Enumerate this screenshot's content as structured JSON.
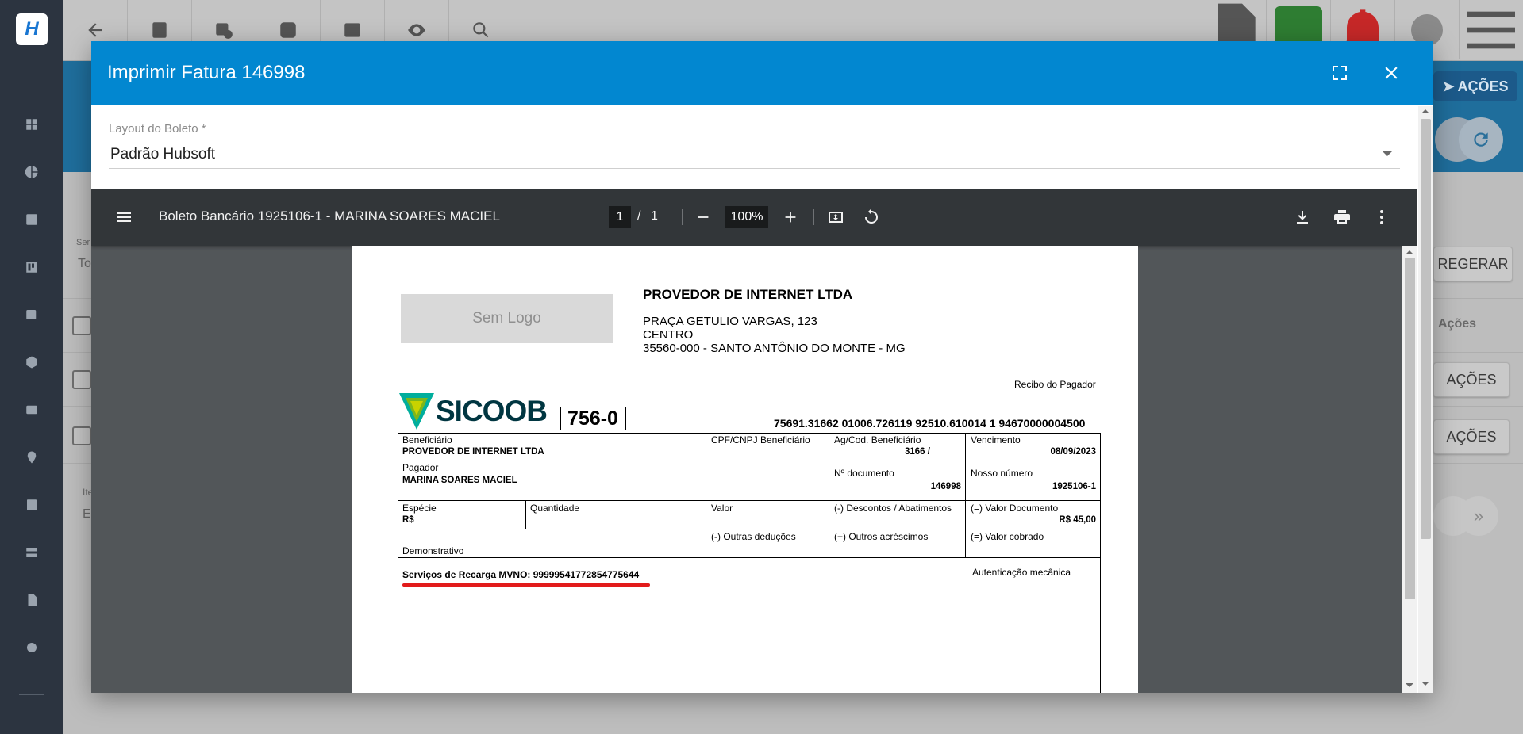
{
  "modal": {
    "title": "Imprimir Fatura 146998",
    "layout_label": "Layout do Boleto *",
    "layout_value": "Padrão Hubsoft"
  },
  "viewer": {
    "title": "Boleto Bancário 1925106-1 - MARINA SOARES MACIEL",
    "page_current": "1",
    "page_sep": "/",
    "page_total": "1",
    "zoom": "100%"
  },
  "boleto": {
    "logo_placeholder": "Sem Logo",
    "company_name": "PROVEDOR DE INTERNET LTDA",
    "address_line1": "PRAÇA GETULIO VARGAS, 123",
    "address_line2": "CENTRO",
    "address_line3": "35560-000 - SANTO ANTÔNIO DO MONTE - MG",
    "receipt_title": "Recibo do Pagador",
    "bank_name": "SICOOB",
    "bank_code": "756-0",
    "digitable_line": "75691.31662 01006.726119 92510.610014 1 94670000004500",
    "beneficiario_label": "Beneficiário",
    "beneficiario_value": "PROVEDOR DE INTERNET LTDA",
    "cpf_label": "CPF/CNPJ Beneficiário",
    "agencia_label": "Ag/Cod. Beneficiário",
    "agencia_value": "3166 /",
    "vencimento_label": "Vencimento",
    "vencimento_value": "08/09/2023",
    "pagador_label": "Pagador",
    "pagador_value": "MARINA SOARES MACIEL",
    "ndoc_label": "Nº documento",
    "ndoc_value": "146998",
    "nosso_label": "Nosso número",
    "nosso_value": "1925106-1",
    "especie_label": "Espécie",
    "especie_value": "R$",
    "quantidade_label": "Quantidade",
    "valor_label": "Valor",
    "descontos_label": "(-) Descontos / Abatimentos",
    "valor_doc_label": "(=) Valor Documento",
    "valor_doc_value": "R$ 45,00",
    "outras_deducoes_label": "(-) Outras deduções",
    "outros_acrescimos_label": "(+) Outros acréscimos",
    "valor_cobrado_label": "(=) Valor cobrado",
    "demonstrativo_label": "Demonstrativo",
    "servicos_text": "Serviços de Recarga MVNO: 99999541772854775644",
    "autenticacao_label": "Autenticação mecânica"
  },
  "background": {
    "acoes_top_label": "AÇÕES",
    "regerar_label": "REGERAR",
    "acoes_col_label": "Ações",
    "row_acoes_label_1": "AÇÕES",
    "row_acoes_label_2": "AÇÕES",
    "partial_label_1": "Ser",
    "partial_label_2": "To",
    "partial_label_3": "Ite",
    "partial_label_4": "E"
  },
  "colors": {
    "modal_header": "#0287d0",
    "viewer_toolbar": "#323639",
    "viewer_bg": "#525659",
    "highlight_underline": "#e21b1b",
    "sidebar": "#2c3440"
  }
}
